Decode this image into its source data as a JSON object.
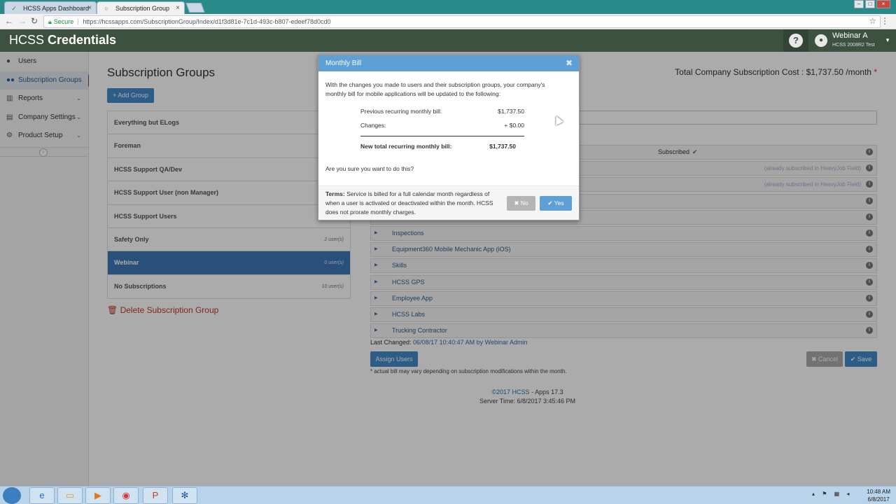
{
  "browser": {
    "tabs": [
      {
        "label": "HCSS Apps Dashboard",
        "active": false
      },
      {
        "label": "Subscription Group",
        "active": true
      }
    ],
    "secure_label": "Secure",
    "url": "https://hcssapps.com/SubscriptionGroup/Index/d1f3d81e-7c1d-493c-b807-edeef78d0cd0"
  },
  "header": {
    "brand_light": "HCSS ",
    "brand_bold": "Credentials",
    "help_label": "?",
    "user_name": "Webinar A",
    "user_sub": "HCSS 2008R2 Test"
  },
  "sidebar": {
    "items": [
      {
        "label": "Users",
        "icon": "user-icon",
        "active": false,
        "expandable": false
      },
      {
        "label": "Subscription Groups",
        "icon": "users-icon",
        "active": true,
        "expandable": false
      },
      {
        "label": "Reports",
        "icon": "bar-chart-icon",
        "active": false,
        "expandable": true
      },
      {
        "label": "Company Settings",
        "icon": "building-icon",
        "active": false,
        "expandable": true
      },
      {
        "label": "Product Setup",
        "icon": "gear-icon",
        "active": false,
        "expandable": true
      }
    ]
  },
  "main": {
    "title": "Subscription Groups",
    "total_cost": "Total Company Subscription Cost : $1,737.50 /month",
    "total_cost_asterisk": "*",
    "add_group": "+ Add Group",
    "groups": [
      {
        "name": "Everything but ELogs",
        "count": ""
      },
      {
        "name": "Foreman",
        "count": ""
      },
      {
        "name": "HCSS Support QA/Dev",
        "count": ""
      },
      {
        "name": "HCSS Support User (non Manager)",
        "count": ""
      },
      {
        "name": "HCSS Support Users",
        "count": ""
      },
      {
        "name": "Safety Only",
        "count": "2 user(s)"
      },
      {
        "name": "Webinar",
        "count": "0 user(s)",
        "selected": true
      },
      {
        "name": "No Subscriptions",
        "count": "10 user(s)"
      }
    ],
    "delete_group": "Delete Subscription Group",
    "apps_partial": [
      {
        "status": "Subscribed",
        "already": ""
      },
      {
        "status": "",
        "already": "(already subscribed in HeavyJob Field)"
      },
      {
        "status": "",
        "already": "(already subscribed in HeavyJob Field)"
      },
      {
        "status": "",
        "already": ""
      },
      {
        "status": "",
        "already": ""
      }
    ],
    "apps": [
      "Inspections",
      "Equipment360 Mobile Mechanic App (iOS)",
      "Skills",
      "HCSS GPS",
      "Employee App",
      "HCSS Labs",
      "Trucking Contractor"
    ],
    "last_changed_label": "Last Changed: ",
    "last_changed_value": "06/08/17 10:40:47 AM by Webinar Admin",
    "assign_users": "Assign Users",
    "note": "* actual bill may vary depending on subscription modifications within the month.",
    "cancel": "Cancel",
    "save": "Save",
    "footer_copyright": "©2017 HCSS",
    "footer_apps": " - Apps 17.3",
    "footer_server": "Server Time: 6/8/2017 3:45:46 PM"
  },
  "modal": {
    "title": "Monthly Bill",
    "intro": "With the changes you made to users and their subscription groups, your company's monthly bill for mobile applications will be updated to the following:",
    "rows": [
      {
        "label": "Previous recurring monthly bill:",
        "value": "$1,737.50"
      },
      {
        "label": "Changes:",
        "value": "+  $0.00"
      }
    ],
    "total_label": "New total recurring monthly bill:",
    "total_value": "$1,737.50",
    "confirm": "Are you sure you want to do this?",
    "terms_label": "Terms:",
    "terms_text": " Service is billed for a full calendar month regardless of when a user is activated or deactivated within the month. HCSS does not prorate monthly charges.",
    "no_label": "No",
    "yes_label": "Yes"
  },
  "taskbar": {
    "time": "10:48 AM",
    "date": "6/8/2017"
  }
}
